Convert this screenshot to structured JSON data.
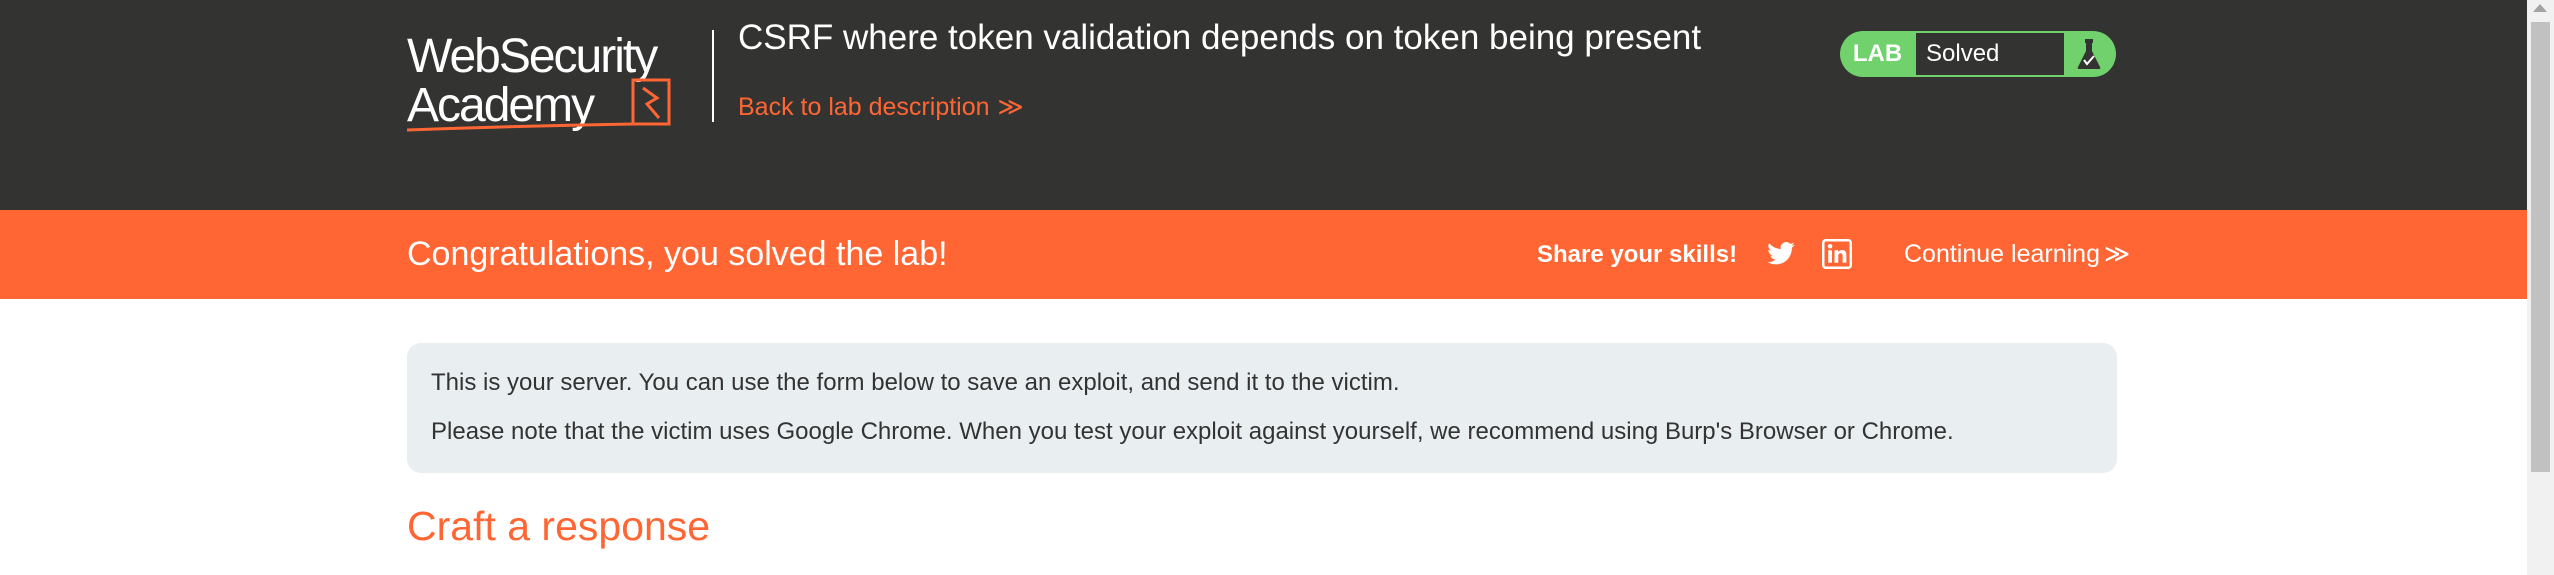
{
  "header": {
    "logo_line1": "WebSecurity",
    "logo_line2": "Academy",
    "lab_title": "CSRF where token validation depends on token being present",
    "back_link": "Back to lab description",
    "back_chevron": "≫",
    "status": {
      "tag": "LAB",
      "value": "Solved",
      "icon": "flask-icon"
    }
  },
  "banner": {
    "message": "Congratulations, you solved the lab!",
    "share_label": "Share your skills!",
    "share_icons": [
      "twitter-icon",
      "linkedin-icon"
    ],
    "continue_label": "Continue learning",
    "continue_chevron": "≫"
  },
  "main": {
    "info_lines": [
      "This is your server. You can use the form below to save an exploit, and send it to the victim.",
      "Please note that the victim uses Google Chrome. When you test your exploit against yourself, we recommend using Burp's Browser or Chrome."
    ],
    "section_title": "Craft a response"
  },
  "colors": {
    "header_bg": "#333332",
    "accent_orange": "#ff6633",
    "solved_green": "#70d16d",
    "info_bg": "#e9eef1"
  }
}
